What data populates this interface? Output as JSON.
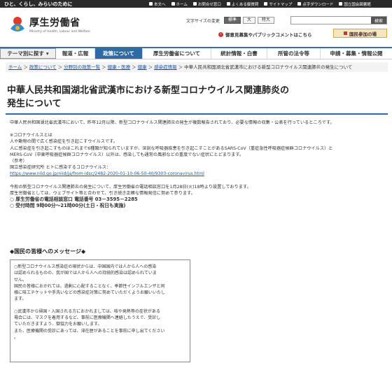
{
  "topbar": {
    "tagline": "ひと、くらし、みらいのために",
    "links": [
      "本文へ",
      "ホーム",
      "お問合せ窓口",
      "よくある御質問",
      "サイトマップ",
      "点字ダウンロード",
      "国立国会図書館",
      "ヨミ上げ・Webアクセシビリティ"
    ]
  },
  "header": {
    "site_title": "厚生労働省",
    "site_subtitle": "Ministry of Health, Labour and Welfare",
    "text_size_label": "文字サイズの変更",
    "text_size_options": [
      "標準",
      "大",
      "特大"
    ],
    "search_placeholder": "",
    "search_button": "検索",
    "recruit_link": "御意見募集やパブリックコメントはこちら",
    "participate_button": "国民参加の場"
  },
  "nav": {
    "items": [
      "テーマ別に探す",
      "報道・広報",
      "政策について",
      "厚生労働省について",
      "統計情報・白書",
      "所管の法令等",
      "申請・募集・情報公開"
    ],
    "active": "政策について"
  },
  "breadcrumb": {
    "items": [
      "ホーム",
      "政策について",
      "分野別の政策一覧",
      "健康・医療",
      "健康",
      "感染症情報"
    ],
    "current": "中華人民共和国湖北省武漢市における新型コロナウイルス関連肺炎の発生について"
  },
  "page": {
    "title": "中華人民共和国湖北省武漢市における新型コロナウイルス関連肺炎の発生について",
    "intro": "中華人民共和国湖北省武漢市において、昨年12月以降、新型コロナウイルス関連肺炎の発生が複数報告されており、必要な情報の収集・公表を行っているところです。",
    "corona_lines": [
      "※コロナウイルスとは",
      "人や動物の間で広く感染症を引き起こすウイルスです。",
      "人に感染症を引き起こすものはこれまで6種類が知られていますが、深刻な呼吸器疾患を引き起こすことがあるSARS-CoV（重症急性呼吸器症候群コロナウイルス）と",
      "MERS-CoV（中東呼吸器症候群コロナウイルス）以外は、感染しても通常の風邪などの重度でない症状にとどまります。",
      "（参考）",
      "国立感染症研究所 ヒトに感染するコロナウイルス："
    ],
    "reference_url": "https://www.niid.go.jp/niid/ja/from-idsc/2482-2020-01-10-06-50-40/9303-coronavirus.html",
    "call_lines": [
      "今般の新型コロナウイルス関連肺炎の発生について、厚生労働省の電話相談窓口を1月28日(火)18時より設置しております。",
      "厚生労働省としては、ウェブサイト等と合わせて、引き続き正確な情報発信に努めて参ります。"
    ],
    "phone_line": "○ 厚生労働省の電話相談窓口 電話番号 03－3595－2285",
    "hours_line": "○ 受付時間 9時00分～21時00分(土日・祝日も実施)",
    "message_heading": "◆国民の皆様へのメッセージ◆",
    "message_lines": [
      "○新型コロナウイルス感染症の現状からは、中国国内では人から人への感染",
      "は認められるものの、我が国では人から人への持続的感染は認められていま",
      "せん。",
      "国民の皆様におかれては、過剰に心配することなく、季節性インフルエンザと同",
      "様に咳エチケットや手洗いなどの感染症対策に努めていただくようお願いいたし",
      "ます。",
      "",
      "○武漢市から帰国・入国される方におかれましては、咳や発熱等の症状がある",
      "場合には、マスクを着用するなど、事前に医療機関へ連絡したうえで、受診し",
      "ていただきますよう、御協力をお願いします。",
      "また、医療機関の受診にあっては、滞在歴があることを事前に申し出てください",
      "。"
    ]
  },
  "colors": {
    "nav_accent": "#2f6aa8",
    "link": "#1a55a8",
    "topbar_bg": "#2a2a2a",
    "participate_bg": "#f6e7b8"
  }
}
